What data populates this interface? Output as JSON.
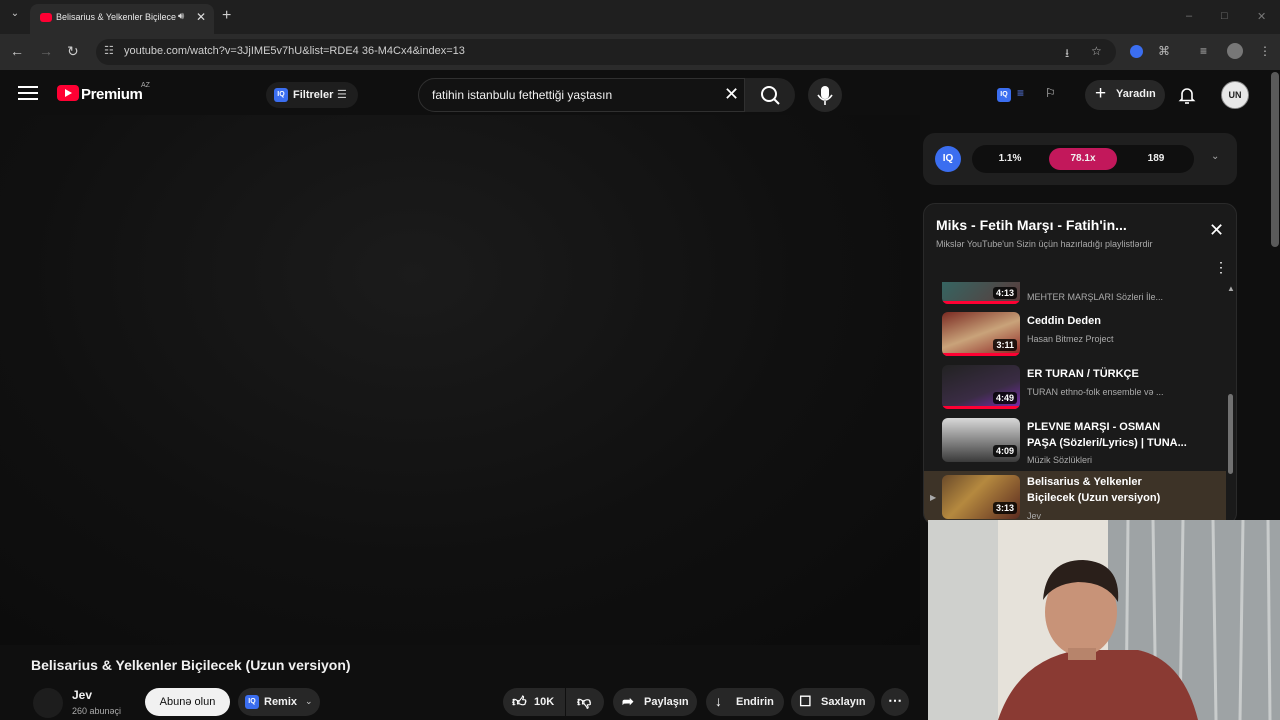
{
  "browser": {
    "tab_title": "Belisarius & Yelkenler Biçilecek (U",
    "url": "youtube.com/watch?v=3JjIME5v7hU&list=RDE4 36-M4Cx4&index=13"
  },
  "header": {
    "brand": "Premium",
    "country": "AZ",
    "iq_label": "IQ",
    "filters_label": "Filtreler",
    "search_value": "fatihin istanbulu fethettiği yaştasın",
    "create_label": "Yaradın",
    "avatar_text": "UN"
  },
  "iq_stats": {
    "percent": "1.1%",
    "multiplier": "78.1x",
    "count": "189",
    "accent": "#c2185b"
  },
  "playlist": {
    "title": "Miks - Fetih Marşı - Fatih'in...",
    "subtitle": "Mikslər YouTube'un Sizin üçün hazırladığı playlistlərdir",
    "items": [
      {
        "title": "",
        "channel": "MEHTER MARŞLARI Sözleri İle...",
        "duration": "4:13"
      },
      {
        "title": "Ceddin Deden",
        "channel": "Hasan Bitmez Project",
        "duration": "3:11"
      },
      {
        "title": "ER TURAN / TÜRKÇE",
        "channel": "TURAN ethno-folk ensemble və ...",
        "duration": "4:49"
      },
      {
        "title": "PLEVNE MARŞI - OSMAN PAŞA (Sözleri/Lyrics) | TUNA...",
        "channel": "Müzik Sözlükleri",
        "duration": "4:09"
      },
      {
        "title": "Belisarius & Yelkenler Biçilecek (Uzun versiyon)",
        "channel": "Jev",
        "duration": "3:13"
      }
    ]
  },
  "video": {
    "title": "Belisarius & Yelkenler Biçilecek (Uzun versiyon)",
    "channel": "Jev",
    "subscribers": "260 abunəçi",
    "subscribe_label": "Abunə olun",
    "remix_label": "Remix",
    "likes": "10K",
    "share_label": "Paylaşın",
    "download_label": "Endirin",
    "save_label": "Saxlayın"
  }
}
